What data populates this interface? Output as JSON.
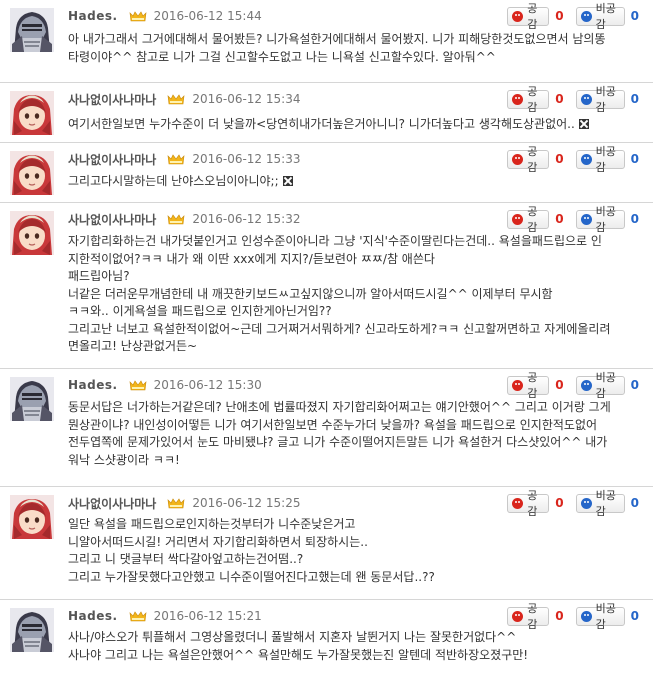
{
  "vote_labels": {
    "like": "공감",
    "dislike": "비공감"
  },
  "colors": {
    "like": "#d9251c",
    "dislike": "#2566c9",
    "border": "#d6d6d6"
  },
  "comments": [
    {
      "author": "Hades.",
      "avatar": "knight-avatar",
      "date": "2016-06-12 15:44",
      "likes": "0",
      "dislikes": "0",
      "lines": [
        "아 내가그래서 그거에대해서 물어봤든? 니가욕설한거에대해서 물어봤지. 니가 피해당한것도없으면서 남의똥",
        "타령이야^^ 참고로 니가 그걸 신고할수도없고 나는 니욕설 신고할수있다. 알아둬^^"
      ]
    },
    {
      "author": "사나없이사나마나",
      "avatar": "girl-avatar",
      "date": "2016-06-12 15:34",
      "likes": "0",
      "dislikes": "0",
      "lines": [
        "여기서한일보면 누가수준이 더 낮을까<당연히내가더높은거아니니? 니가더높다고 생각해도상관없어.."
      ]
    },
    {
      "author": "사나없이사나마나",
      "avatar": "girl-avatar",
      "date": "2016-06-12 15:33",
      "likes": "0",
      "dislikes": "0",
      "lines": [
        "그리고다시말하는데 난야스오님이아니야;;"
      ]
    },
    {
      "author": "사나없이사나마나",
      "avatar": "girl-avatar",
      "date": "2016-06-12 15:32",
      "likes": "0",
      "dislikes": "0",
      "lines": [
        "자기합리화하는건 내가덧붙인거고 인성수준이아니라 그냥 '지식'수준이딸린다는건데.. 욕설을패드립으로 인",
        "지한적이없어?ㅋㅋ 내가 왜 이딴 xxx에게 지지?/듣보련아 ㅉㅉ/참 애쓴다",
        "패드립아님?",
        "너같은 더러운무개념한테 내 깨끗한키보드ㅆ고싶지않으니까 알아서떠드시길^^ 이제부터 무시함",
        "ㅋㅋ와.. 이게욕설을 패드립으로 인지한게아닌거임??",
        "그리고난 너보고 욕설한적이없어~근데 그거쩌거서뭐하게? 신고라도하게?ㅋㅋ 신고할꺼면하고 자게에올리려",
        "면올리고! 난상관없거든~"
      ]
    },
    {
      "author": "Hades.",
      "avatar": "knight-avatar",
      "date": "2016-06-12 15:30",
      "likes": "0",
      "dislikes": "0",
      "lines": [
        "동문서답은 너가하는거같은데? 난애초에 법률따졌지 자기합리화어쩌고는 얘기안했어^^ 그리고 이거랑 그게",
        "뭔상관이냐? 내인성이어떻든 니가 여기서한일보면 수준누가더 낮을까? 욕설을 패드립으로 인지한적도없어",
        "전두엽쪽에 문제가있어서 눈도 마비됐냐? 글고 니가 수준이떨어지든말든 니가 욕설한거 다스샷있어^^ 내가",
        "워낙 스샷광이라 ㅋㅋ!"
      ]
    },
    {
      "author": "사나없이사나마나",
      "avatar": "girl-avatar",
      "date": "2016-06-12 15:25",
      "likes": "0",
      "dislikes": "0",
      "lines": [
        "일단 욕설을 패드립으로인지하는것부터가 니수준낮은거고",
        "니얄아서떠드시길! 거리면서 자기합리화하면서 퇴장하시는..",
        "그리고 니 댓글부터 싹다갈아엎고하는건어떰..?",
        "그리고 누가잘못했다고안했고 니수준이떨어진다고했는데 왠 동문서답..??"
      ]
    },
    {
      "author": "Hades.",
      "avatar": "knight-avatar",
      "date": "2016-06-12 15:21",
      "likes": "0",
      "dislikes": "0",
      "lines": [
        "사나/야스오가 튀플해서 그영상올렸더니 풀발해서 지혼자 날뛴거지 나는 잘못한거없다^^",
        "사나야 그리고 나는 욕설은안했어^^ 욕설만해도 누가잘못했는진 알텐데 적반하장오졌구만!"
      ]
    }
  ]
}
